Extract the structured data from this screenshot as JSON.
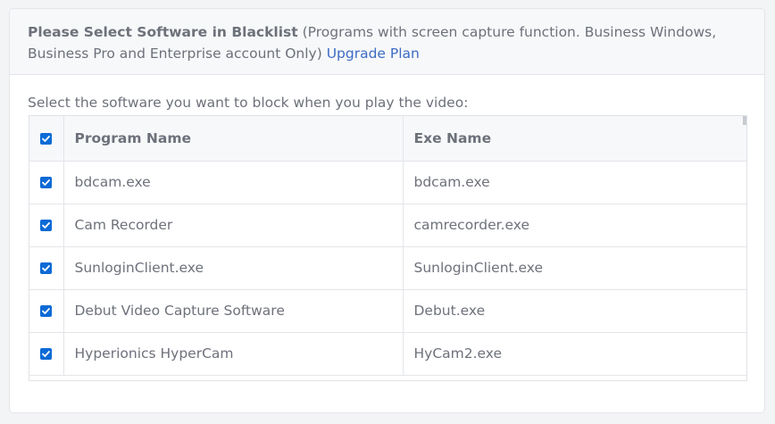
{
  "header": {
    "title": "Please Select Software in Blacklist",
    "description": " (Programs with screen capture function. Business Windows, Business Pro and Enterprise account Only) ",
    "upgrade_link": "Upgrade Plan"
  },
  "instruction": "Select the software you want to block when you play the video:",
  "table": {
    "columns": [
      "Program Name",
      "Exe Name"
    ],
    "select_all_checked": true,
    "rows": [
      {
        "program": "bdcam.exe",
        "exe": "bdcam.exe",
        "checked": true
      },
      {
        "program": "Cam Recorder",
        "exe": "camrecorder.exe",
        "checked": true
      },
      {
        "program": "SunloginClient.exe",
        "exe": "SunloginClient.exe",
        "checked": true
      },
      {
        "program": "Debut Video Capture Software",
        "exe": "Debut.exe",
        "checked": true
      },
      {
        "program": "Hyperionics HyperCam",
        "exe": "HyCam2.exe",
        "checked": true
      }
    ]
  },
  "colors": {
    "accent": "#0b6ad6",
    "link": "#3d6cc4",
    "text": "#6d717a"
  }
}
